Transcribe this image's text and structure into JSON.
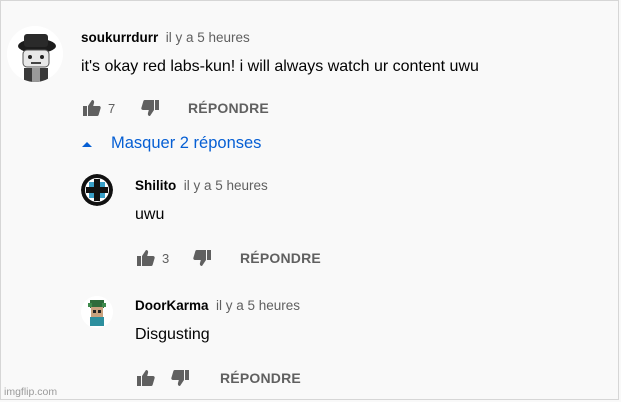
{
  "comments": [
    {
      "author": "soukurrdurr",
      "time": "il y a 5 heures",
      "text": "it's okay red labs-kun! i will always watch ur content uwu",
      "likes": "7",
      "reply_label": "RÉPONDRE",
      "avatar": "hat-character-avatar"
    }
  ],
  "replies_toggle": {
    "label": "Masquer 2 réponses",
    "icon": "chevron-up-icon"
  },
  "replies": [
    {
      "author": "Shilito",
      "time": "il y a 5 heures",
      "text": "uwu",
      "likes": "3",
      "reply_label": "RÉPONDRE",
      "avatar": "pattern-avatar"
    },
    {
      "author": "DoorKarma",
      "time": "il y a 5 heures",
      "text": "Disgusting",
      "likes": "",
      "reply_label": "RÉPONDRE",
      "avatar": "pixel-character-avatar"
    }
  ],
  "watermark": "imgflip.com",
  "colors": {
    "background": "#f9f9f9",
    "link": "#065fd4",
    "muted": "#606060",
    "icon": "#606060"
  }
}
